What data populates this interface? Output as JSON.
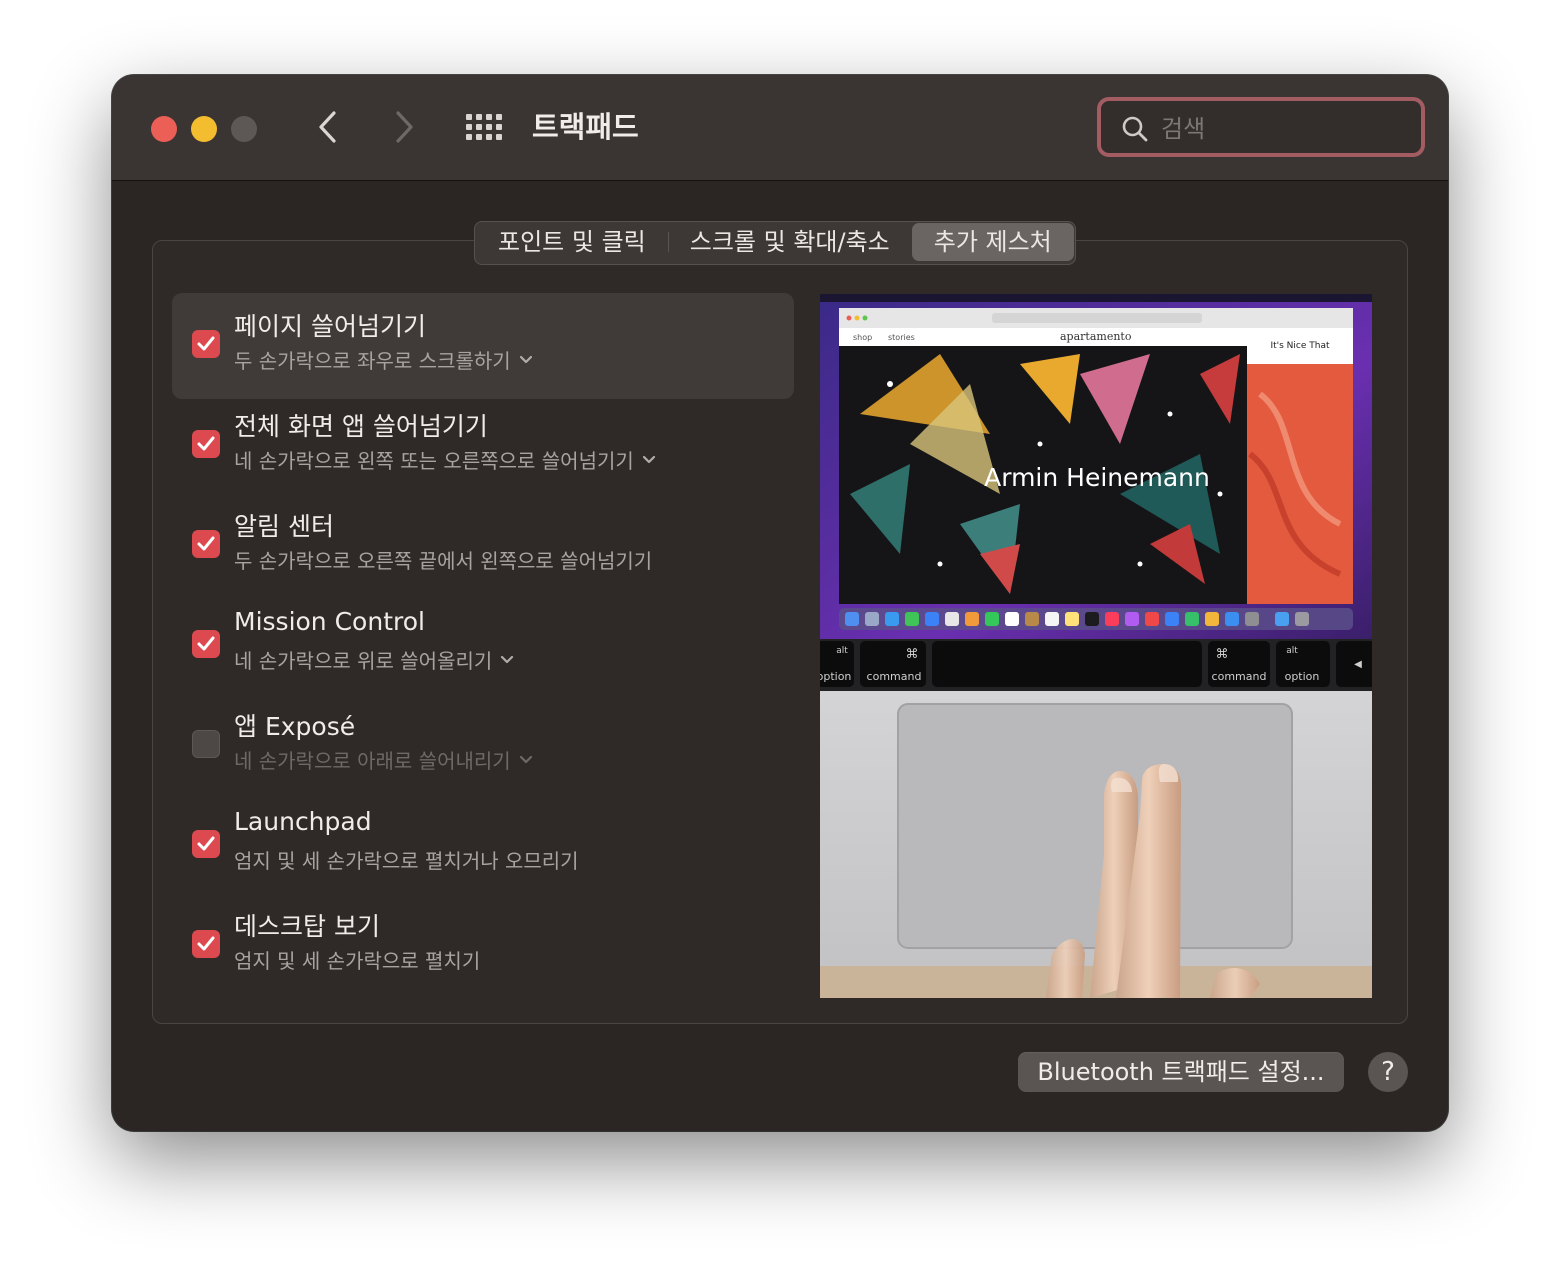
{
  "window": {
    "title": "트랙패드",
    "search_placeholder": "검색"
  },
  "tabs": [
    {
      "label": "포인트 및 클릭",
      "active": false
    },
    {
      "label": "스크롤 및 확대/축소",
      "active": false
    },
    {
      "label": "추가 제스처",
      "active": true
    }
  ],
  "gestures": [
    {
      "title": "페이지 쓸어넘기기",
      "subtitle": "두 손가락으로 좌우로 스크롤하기",
      "checked": true,
      "dropdown": true
    },
    {
      "title": "전체 화면 앱 쓸어넘기기",
      "subtitle": "네 손가락으로 왼쪽 또는 오른쪽으로 쓸어넘기기",
      "checked": true,
      "dropdown": true
    },
    {
      "title": "알림 센터",
      "subtitle": "두 손가락으로 오른쪽 끝에서 왼쪽으로 쓸어넘기기",
      "checked": true,
      "dropdown": false
    },
    {
      "title": "Mission Control",
      "subtitle": "네 손가락으로 위로 쓸어올리기",
      "checked": true,
      "dropdown": true
    },
    {
      "title": "앱 Exposé",
      "subtitle": "네 손가락으로 아래로 쓸어내리기",
      "checked": false,
      "dropdown": true
    },
    {
      "title": "Launchpad",
      "subtitle": "엄지 및 세 손가락으로 펼치거나 오므리기",
      "checked": true,
      "dropdown": false
    },
    {
      "title": "데스크탑 보기",
      "subtitle": "엄지 및 세 손가락으로 펼치기",
      "checked": true,
      "dropdown": false
    }
  ],
  "preview": {
    "browser_tabs": [
      "shop",
      "stories"
    ],
    "site_name": "apartamento",
    "side_site": "It's Nice That",
    "artist": "Armin Heinemann",
    "keys": {
      "alt_left": "alt",
      "option_left": "option",
      "cmd_symbol": "⌘",
      "command_left": "command",
      "command_right": "command",
      "alt_right": "alt",
      "option_right": "option",
      "arrow": "◀"
    }
  },
  "footer": {
    "bluetooth_button": "Bluetooth 트랙패드 설정...",
    "help_button": "?"
  },
  "colors": {
    "accent": "#dc4a4f",
    "window_bg": "#2b2624",
    "search_focus": "#a35c62"
  }
}
